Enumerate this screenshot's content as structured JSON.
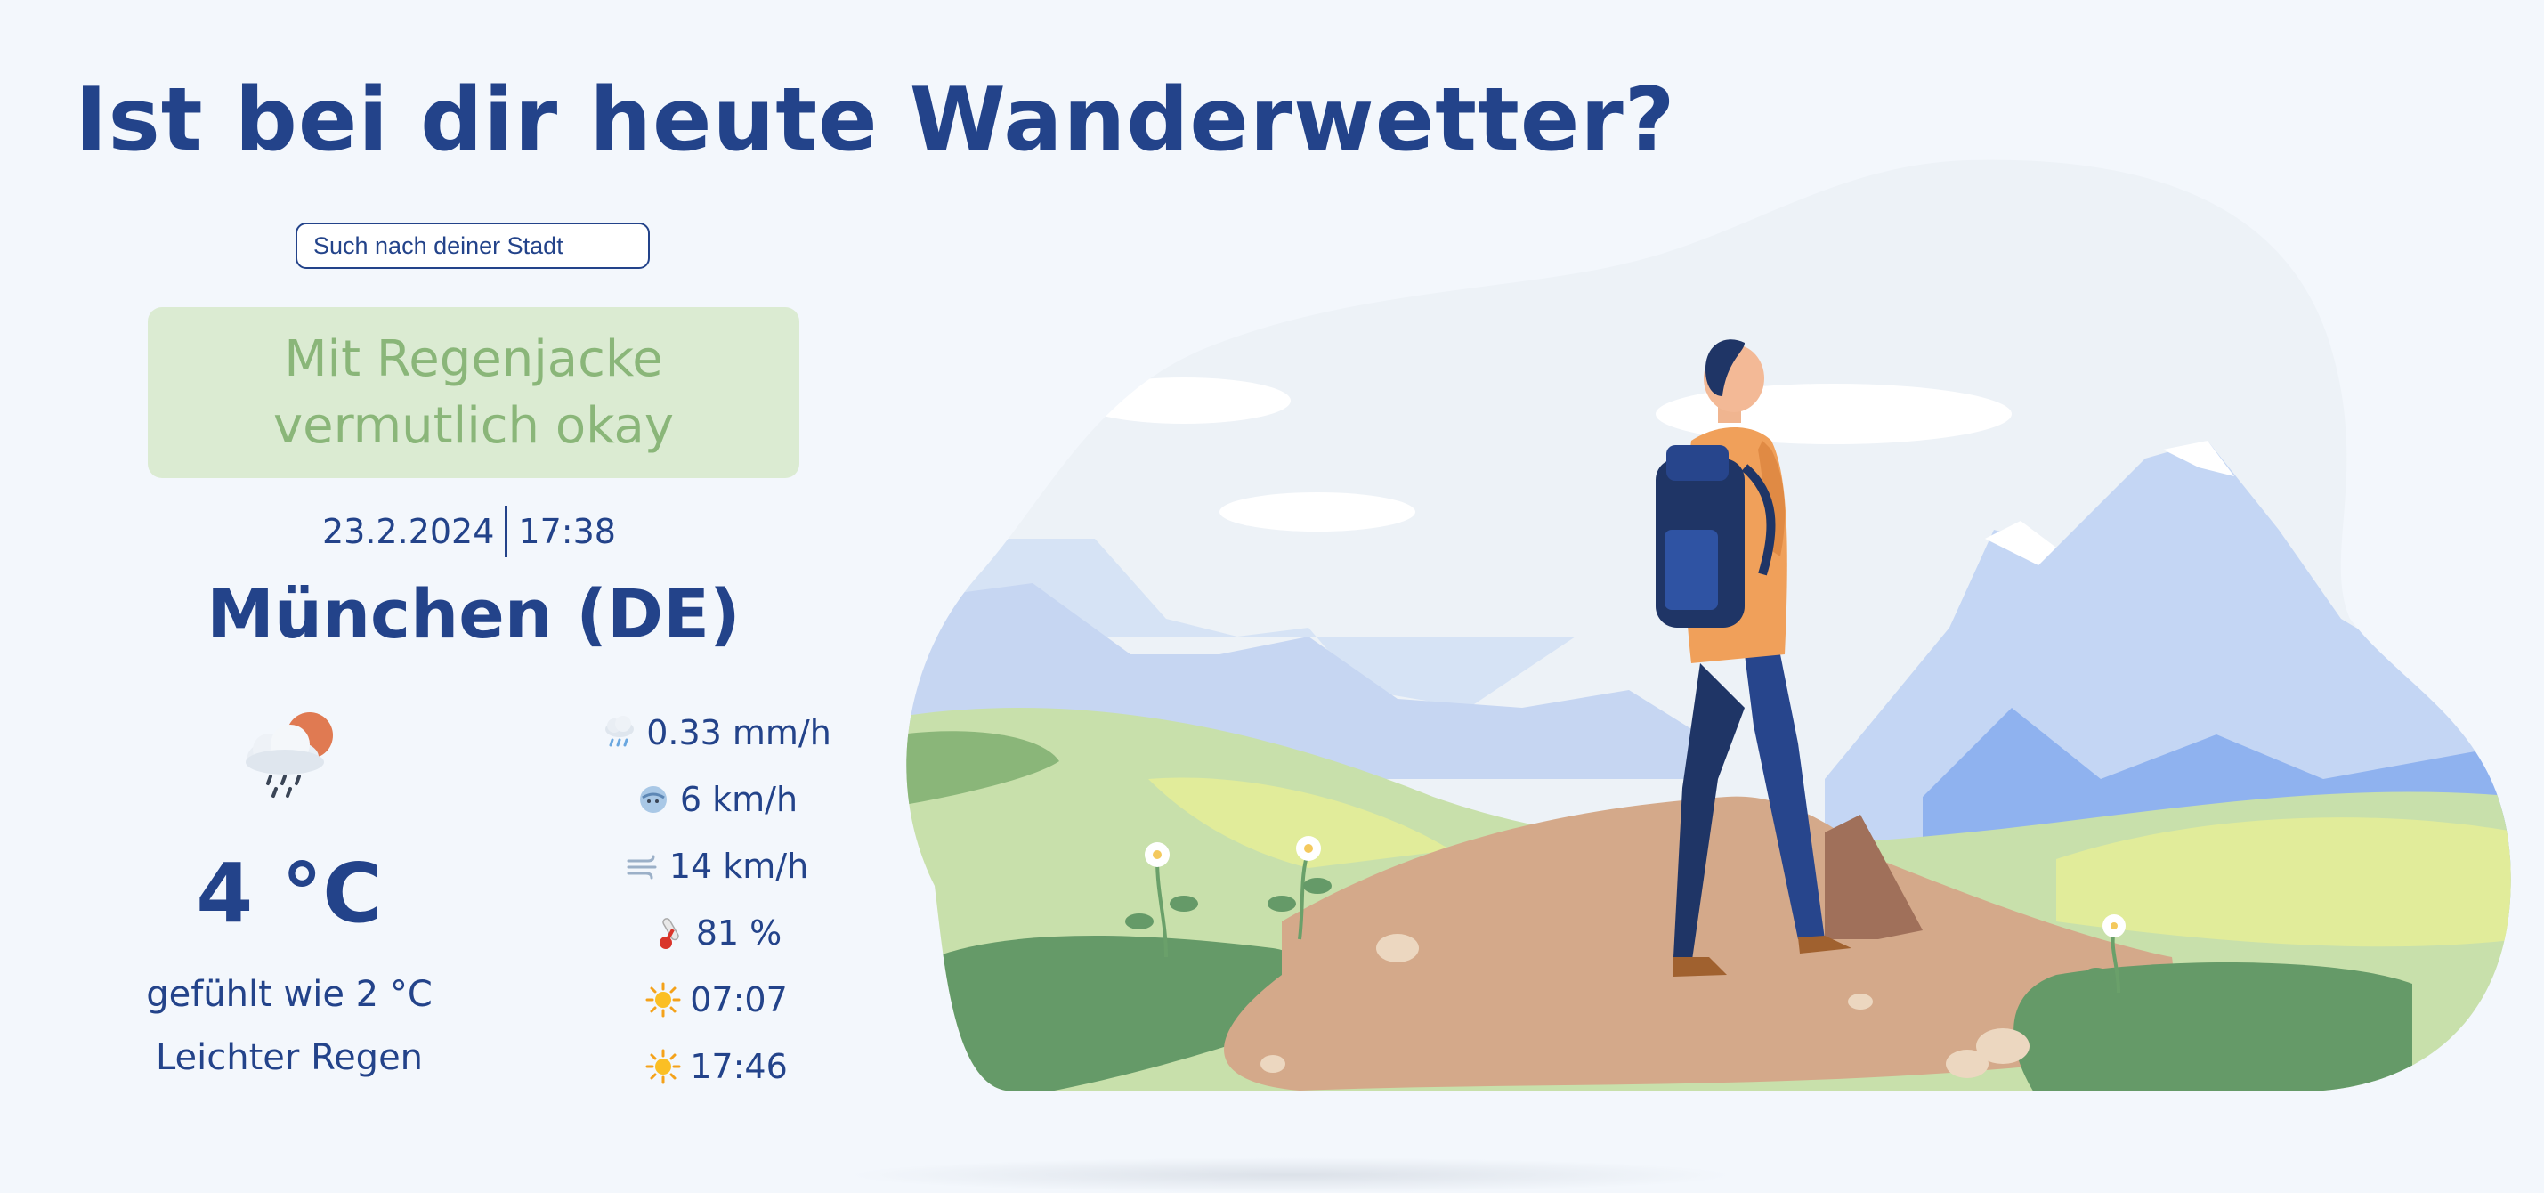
{
  "page": {
    "title": "Ist bei dir heute Wanderwetter?"
  },
  "search": {
    "placeholder": "Such nach deiner Stadt"
  },
  "verdict": {
    "text": "Mit Regenjacke vermutlich okay"
  },
  "datetime": {
    "date": "23.2.2024",
    "time": "17:38"
  },
  "location": {
    "city": "München (DE)"
  },
  "weather": {
    "icon": "sun-behind-rain-cloud-icon",
    "temperature": "4 °C",
    "feels_like": "gefühlt wie 2 °C",
    "description": "Leichter Regen"
  },
  "stats": [
    {
      "icon": "rain-cloud-icon",
      "value": "0.33 mm/h"
    },
    {
      "icon": "wind-face-icon",
      "value": "6 km/h"
    },
    {
      "icon": "wind-gust-icon",
      "value": "14 km/h"
    },
    {
      "icon": "thermometer-icon",
      "value": "81 %"
    },
    {
      "icon": "sunrise-sun-icon",
      "value": "07:07"
    },
    {
      "icon": "sunset-sun-icon",
      "value": "17:46"
    }
  ],
  "colors": {
    "brand": "#23438a",
    "background": "#f3f7fc",
    "verdict_bg": "#dbebd2",
    "verdict_text": "#8ab679"
  }
}
